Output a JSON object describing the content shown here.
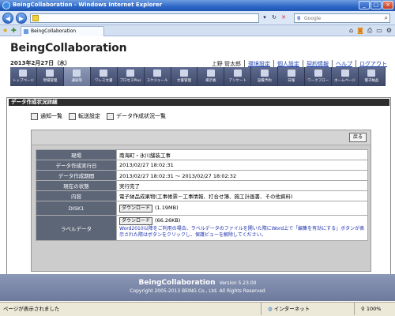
{
  "window": {
    "title": "BeingCollaboration - Windows Internet Explorer",
    "controls": [
      "_",
      "□",
      "×"
    ]
  },
  "address": {
    "url": "",
    "search_placeholder": "Google",
    "search_logo": "g"
  },
  "tab": {
    "label": "BeingCollaboration"
  },
  "app": {
    "title": "BeingCollaboration",
    "date": "2013年2月27日（水）",
    "user": "上野 管太郎",
    "links": [
      "環境設定",
      "個人設定",
      "契約情報",
      "ヘルプ",
      "ログアウト"
    ]
  },
  "menu": [
    {
      "label": "トップページ",
      "icon": "home-icon"
    },
    {
      "label": "現場管理",
      "icon": "site-icon"
    },
    {
      "label": "通知等",
      "icon": "mail-icon"
    },
    {
      "label": "ワレス文書",
      "icon": "document-icon"
    },
    {
      "label": "プロセスPlus",
      "icon": "process-icon"
    },
    {
      "label": "スケジュール",
      "icon": "calendar-icon"
    },
    {
      "label": "文書管理",
      "icon": "folder-icon"
    },
    {
      "label": "掲示板",
      "icon": "board-icon"
    },
    {
      "label": "アンケート",
      "icon": "survey-icon"
    },
    {
      "label": "設備予約",
      "icon": "reserve-icon"
    },
    {
      "label": "日報",
      "icon": "report-icon"
    },
    {
      "label": "ワークフロー",
      "icon": "workflow-icon"
    },
    {
      "label": "ホームページ",
      "icon": "homepage-icon"
    },
    {
      "label": "電子納品",
      "icon": "delivery-icon"
    }
  ],
  "section": {
    "title": "データ作成状況詳細"
  },
  "subtabs": [
    {
      "label": "通知一覧",
      "icon": "notification-list-icon"
    },
    {
      "label": "転送設定",
      "icon": "forward-settings-icon"
    },
    {
      "label": "データ作成状況一覧",
      "icon": "data-list-icon"
    }
  ],
  "detail": {
    "back_label": "戻る",
    "rows": [
      {
        "key": "現場",
        "value": "南海町・氷川舗装工事"
      },
      {
        "key": "データ作成実行日",
        "value": "2013/02/27 18:02:31"
      },
      {
        "key": "データ作成期間",
        "value": "2013/02/27 18:02:31 ～ 2013/02/27 18:02:32"
      },
      {
        "key": "現在の状態",
        "value": "実行完了"
      },
      {
        "key": "内容",
        "value": "電子納品成果物(工事帳票－工事情報、打合せ簿、施工計画書、その他資料)"
      },
      {
        "key": "DISK1",
        "button": "ダウンロード",
        "size": "(1.19MB)"
      },
      {
        "key": "ラベルデータ",
        "button": "ダウンロード",
        "size": "(66.26KB)",
        "note": "Word2010以降をご利用の場合、ラベルデータのファイルを開いた際にWord上で「編集を有効にする」ボタンが表示された際はボタンをクリックし、保護ビューを解除してください。"
      }
    ]
  },
  "footer": {
    "brand": "BeingCollaboration",
    "version": "Version 5.23.00",
    "copyright": "Copyright 2005-2013 BEING Co., Ltd. All Rights Reserved"
  },
  "status": {
    "left": "ページが表示されました",
    "zone": "インターネット",
    "zoom": "100%"
  }
}
